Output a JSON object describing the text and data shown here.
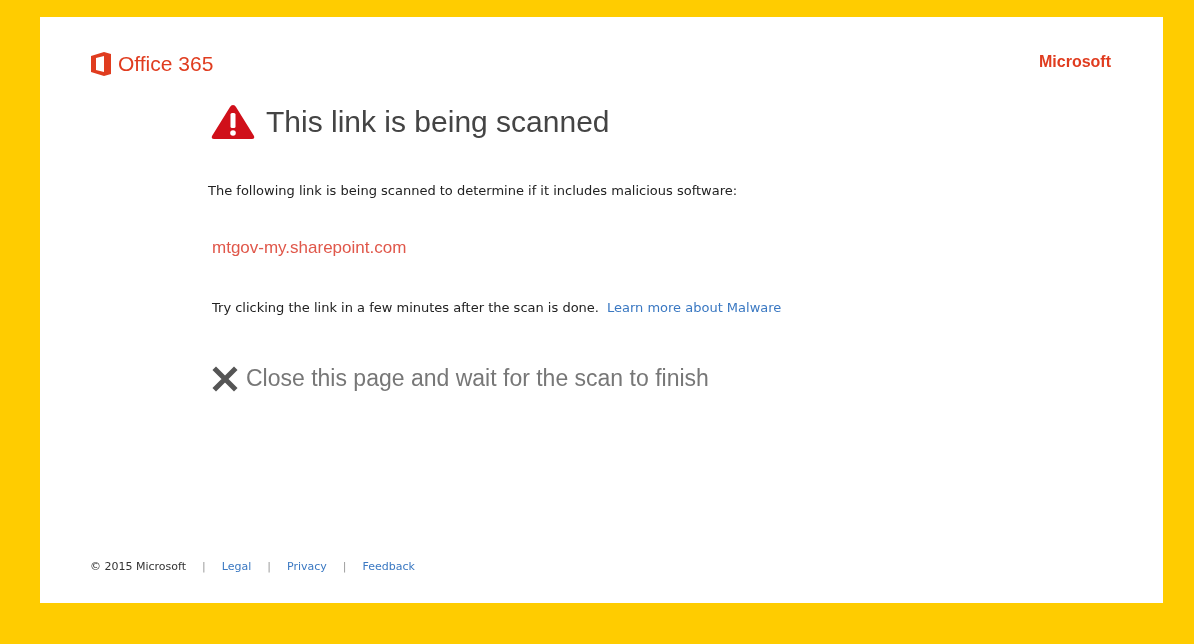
{
  "header": {
    "product": "Office 365",
    "brand": "Microsoft"
  },
  "title": "This link is being scanned",
  "intro": "The following link is being scanned to determine if it includes malicious software:",
  "scanned_url": "mtgov-my.sharepoint.com",
  "hint": "Try clicking the link in a few minutes after the scan is done.",
  "learn_more": "Learn more about Malware",
  "close_action": "Close this page and wait for the scan to finish",
  "footer": [
    {
      "kind": "text",
      "text": "© 2015 Microsoft"
    },
    {
      "kind": "separator",
      "text": "|"
    },
    {
      "kind": "link",
      "text": "Legal"
    },
    {
      "kind": "separator",
      "text": "|"
    },
    {
      "kind": "link",
      "text": "Privacy"
    },
    {
      "kind": "separator",
      "text": "|"
    },
    {
      "kind": "link",
      "text": "Feedback"
    }
  ]
}
